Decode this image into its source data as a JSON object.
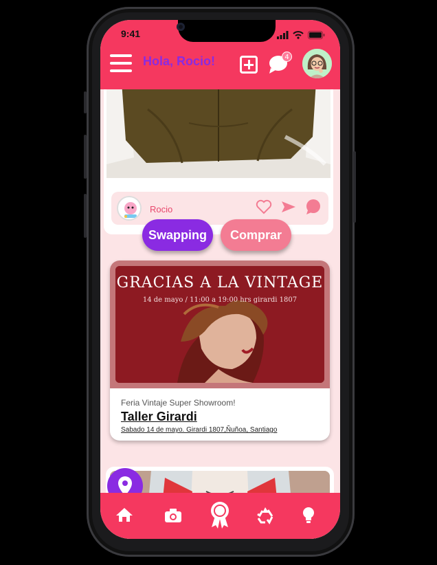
{
  "status": {
    "time": "9:41"
  },
  "header": {
    "greeting": "Hola, Rocio!",
    "chat_badge": "4"
  },
  "post": {
    "user": "Rocio",
    "swap_label": "Swapping",
    "buy_label": "Comprar"
  },
  "event": {
    "image_title": "GRACIAS A LA VINTAGE",
    "image_subtitle": "14 de mayo / 11:00 a 19:00 hrs        girardi 1807",
    "kicker": "Feria Vintaje Super Showroom!",
    "name": "Taller Girardi",
    "address": "Sabado 14 de mayo. Girardi 1807,Ñuñoa, Santiago"
  },
  "tabs": [
    "home-icon",
    "camera-icon",
    "award-icon",
    "recycle-icon",
    "lightbulb-icon"
  ],
  "colors": {
    "primary": "#f5385f",
    "purple": "#8a2be2",
    "pink": "#f37c93",
    "bg": "#fce4e6"
  }
}
